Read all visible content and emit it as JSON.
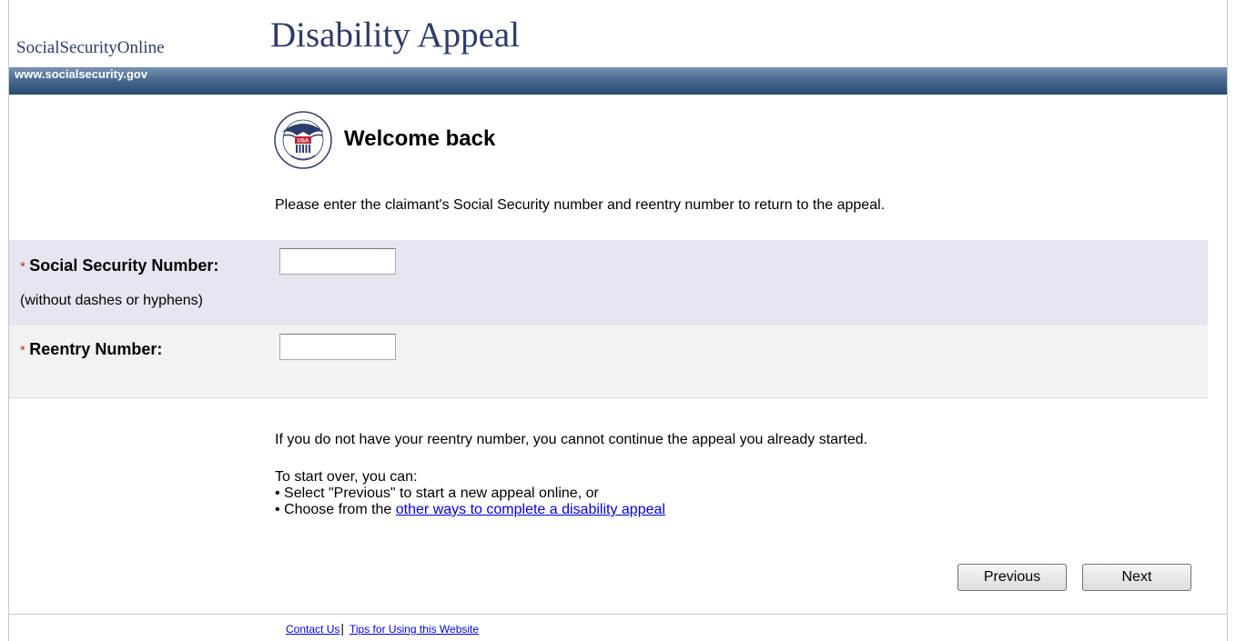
{
  "header": {
    "brand": "SocialSecurityOnline",
    "title": "Disability Appeal",
    "url": "www.socialsecurity.gov"
  },
  "page": {
    "heading": "Welcome back",
    "instructions": "Please enter the claimant's Social Security number and reentry number to return to the appeal.",
    "logo_icon": "ssa-seal-icon"
  },
  "form": {
    "required_marker": "*",
    "ssn_label": "Social Security Number:",
    "ssn_hint": "(without dashes or hyphens)",
    "ssn_value": "",
    "reentry_label": "Reentry Number:",
    "reentry_value": ""
  },
  "notes": {
    "no_reentry": "If you do not have your reentry number, you cannot continue the appeal you already started.",
    "start_over_intro": "To start over, you can:",
    "option_previous": "• Select \"Previous\" to start a new appeal online, or",
    "option_other_prefix": "• Choose from the ",
    "option_other_link": "other ways to complete a disability appeal"
  },
  "buttons": {
    "previous": "Previous",
    "next": "Next"
  },
  "footer": {
    "contact": "Contact Us",
    "separator": "|",
    "tips": "Tips for Using this Website"
  },
  "colors": {
    "brand": "#2c3c6c",
    "bar": "#3c5a80",
    "required": "#e02020",
    "ssn_row_bg": "#e6e6f1",
    "reentry_row_bg": "#f2f2f2",
    "link": "#0000ee"
  }
}
